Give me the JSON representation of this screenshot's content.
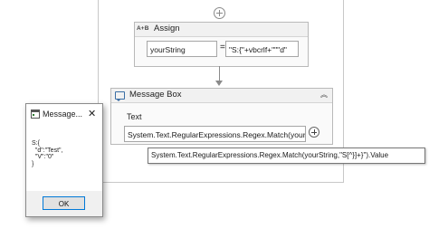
{
  "assign": {
    "icon_text": "A+B",
    "title": "Assign",
    "left_value": "yourString",
    "operator": "=",
    "right_value": "\"S:{\"+vbcrlf+\"\"\"d\""
  },
  "message_box_activity": {
    "title": "Message Box",
    "text_label": "Text",
    "text_value": "System.Text.RegularExpressions.Regex.Match(yourString,\"S[^}]+}\").Value"
  },
  "tooltip": {
    "text": "System.Text.RegularExpressions.Regex.Match(yourString,\"S[^}]+}\").Value"
  },
  "dialog": {
    "title": "Message...",
    "close_glyph": "✕",
    "body": "S:{\n  \"d\":\"Test\",\n  \"V\":\"0\"\n}",
    "ok_label": "OK"
  },
  "icons": {
    "add": "plus-circle-icon",
    "collapse": "double-chevron-up-icon",
    "message": "message-box-icon",
    "app": "window-app-icon",
    "close": "close-icon"
  }
}
